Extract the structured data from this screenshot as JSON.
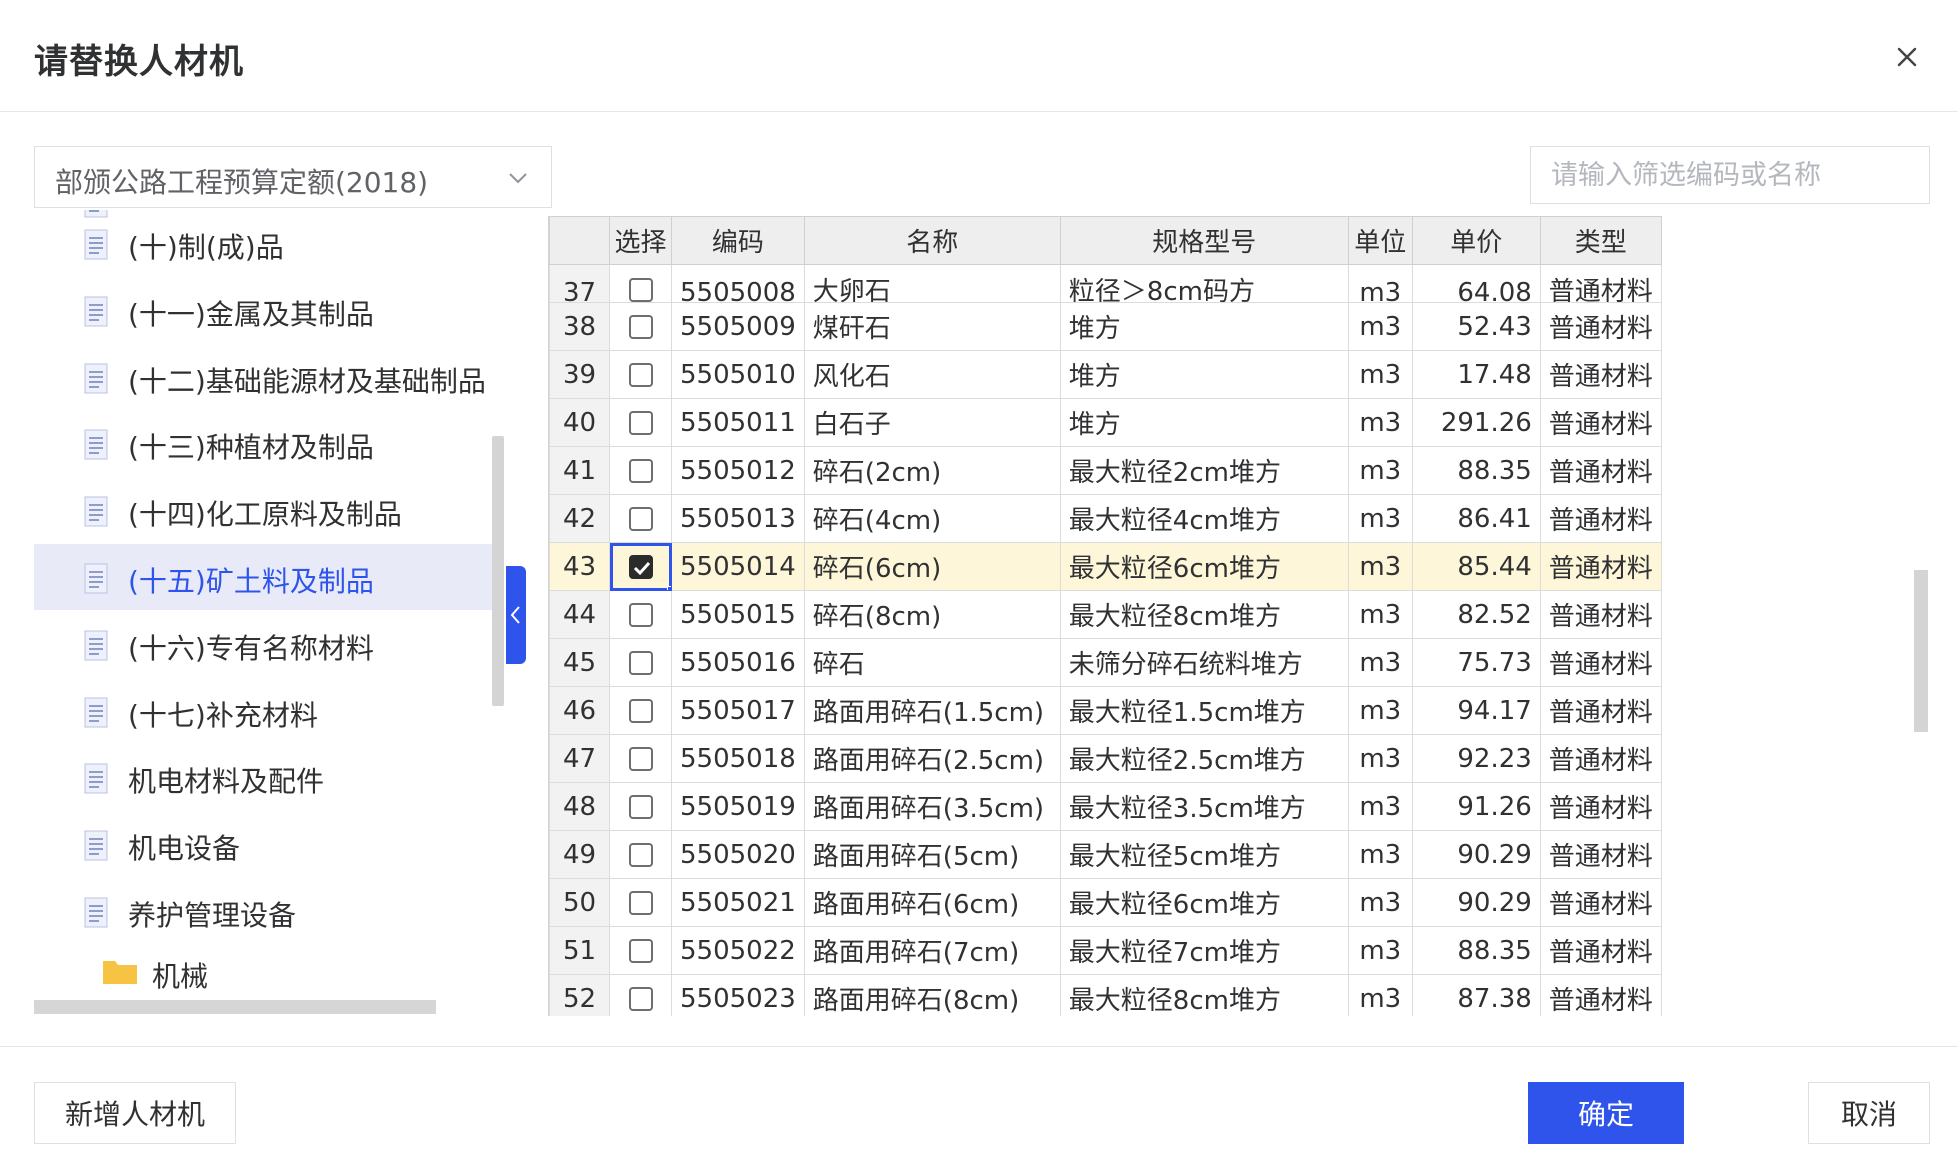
{
  "dialog": {
    "title": "请替换人材机",
    "ok_label": "确定",
    "cancel_label": "取消",
    "add_label": "新增人材机"
  },
  "library": {
    "selected": "部颁公路工程预算定额(2018)"
  },
  "search": {
    "placeholder": "请输入筛选编码或名称",
    "value": ""
  },
  "tree": {
    "items": [
      {
        "label": "(十)制(成)品",
        "selected": false
      },
      {
        "label": "(十一)金属及其制品",
        "selected": false
      },
      {
        "label": "(十二)基础能源材及基础制品",
        "selected": false
      },
      {
        "label": "(十三)种植材及制品",
        "selected": false
      },
      {
        "label": "(十四)化工原料及制品",
        "selected": false
      },
      {
        "label": "(十五)矿土料及制品",
        "selected": true
      },
      {
        "label": "(十六)专有名称材料",
        "selected": false
      },
      {
        "label": "(十七)补充材料",
        "selected": false
      },
      {
        "label": "机电材料及配件",
        "selected": false
      },
      {
        "label": "机电设备",
        "selected": false
      },
      {
        "label": "养护管理设备",
        "selected": false
      }
    ],
    "partial_bottom": "机械"
  },
  "grid": {
    "headers": [
      "",
      "选择",
      "编码",
      "名称",
      "规格型号",
      "单位",
      "单价",
      "类型"
    ],
    "rows": [
      {
        "n": "37",
        "checked": false,
        "code": "5505008",
        "name": "大卵石",
        "spec": "粒径＞8cm码方",
        "unit": "m3",
        "price": "64.08",
        "type": "普通材料"
      },
      {
        "n": "38",
        "checked": false,
        "code": "5505009",
        "name": "煤矸石",
        "spec": "堆方",
        "unit": "m3",
        "price": "52.43",
        "type": "普通材料"
      },
      {
        "n": "39",
        "checked": false,
        "code": "5505010",
        "name": "风化石",
        "spec": "堆方",
        "unit": "m3",
        "price": "17.48",
        "type": "普通材料"
      },
      {
        "n": "40",
        "checked": false,
        "code": "5505011",
        "name": "白石子",
        "spec": "堆方",
        "unit": "m3",
        "price": "291.26",
        "type": "普通材料"
      },
      {
        "n": "41",
        "checked": false,
        "code": "5505012",
        "name": "碎石(2cm)",
        "spec": "最大粒径2cm堆方",
        "unit": "m3",
        "price": "88.35",
        "type": "普通材料"
      },
      {
        "n": "42",
        "checked": false,
        "code": "5505013",
        "name": "碎石(4cm)",
        "spec": "最大粒径4cm堆方",
        "unit": "m3",
        "price": "86.41",
        "type": "普通材料"
      },
      {
        "n": "43",
        "checked": true,
        "code": "5505014",
        "name": "碎石(6cm)",
        "spec": "最大粒径6cm堆方",
        "unit": "m3",
        "price": "85.44",
        "type": "普通材料"
      },
      {
        "n": "44",
        "checked": false,
        "code": "5505015",
        "name": "碎石(8cm)",
        "spec": "最大粒径8cm堆方",
        "unit": "m3",
        "price": "82.52",
        "type": "普通材料"
      },
      {
        "n": "45",
        "checked": false,
        "code": "5505016",
        "name": "碎石",
        "spec": "未筛分碎石统料堆方",
        "unit": "m3",
        "price": "75.73",
        "type": "普通材料"
      },
      {
        "n": "46",
        "checked": false,
        "code": "5505017",
        "name": "路面用碎石(1.5cm)",
        "spec": "最大粒径1.5cm堆方",
        "unit": "m3",
        "price": "94.17",
        "type": "普通材料"
      },
      {
        "n": "47",
        "checked": false,
        "code": "5505018",
        "name": "路面用碎石(2.5cm)",
        "spec": "最大粒径2.5cm堆方",
        "unit": "m3",
        "price": "92.23",
        "type": "普通材料"
      },
      {
        "n": "48",
        "checked": false,
        "code": "5505019",
        "name": "路面用碎石(3.5cm)",
        "spec": "最大粒径3.5cm堆方",
        "unit": "m3",
        "price": "91.26",
        "type": "普通材料"
      },
      {
        "n": "49",
        "checked": false,
        "code": "5505020",
        "name": "路面用碎石(5cm)",
        "spec": "最大粒径5cm堆方",
        "unit": "m3",
        "price": "90.29",
        "type": "普通材料"
      },
      {
        "n": "50",
        "checked": false,
        "code": "5505021",
        "name": "路面用碎石(6cm)",
        "spec": "最大粒径6cm堆方",
        "unit": "m3",
        "price": "90.29",
        "type": "普通材料"
      },
      {
        "n": "51",
        "checked": false,
        "code": "5505022",
        "name": "路面用碎石(7cm)",
        "spec": "最大粒径7cm堆方",
        "unit": "m3",
        "price": "88.35",
        "type": "普通材料"
      },
      {
        "n": "52",
        "checked": false,
        "code": "5505023",
        "name": "路面用碎石(8cm)",
        "spec": "最大粒径8cm堆方",
        "unit": "m3",
        "price": "87.38",
        "type": "普通材料"
      }
    ]
  },
  "colors": {
    "accent": "#2f54eb",
    "selected_row": "#fdf6d8",
    "selected_tree": "#e8ebf7"
  }
}
